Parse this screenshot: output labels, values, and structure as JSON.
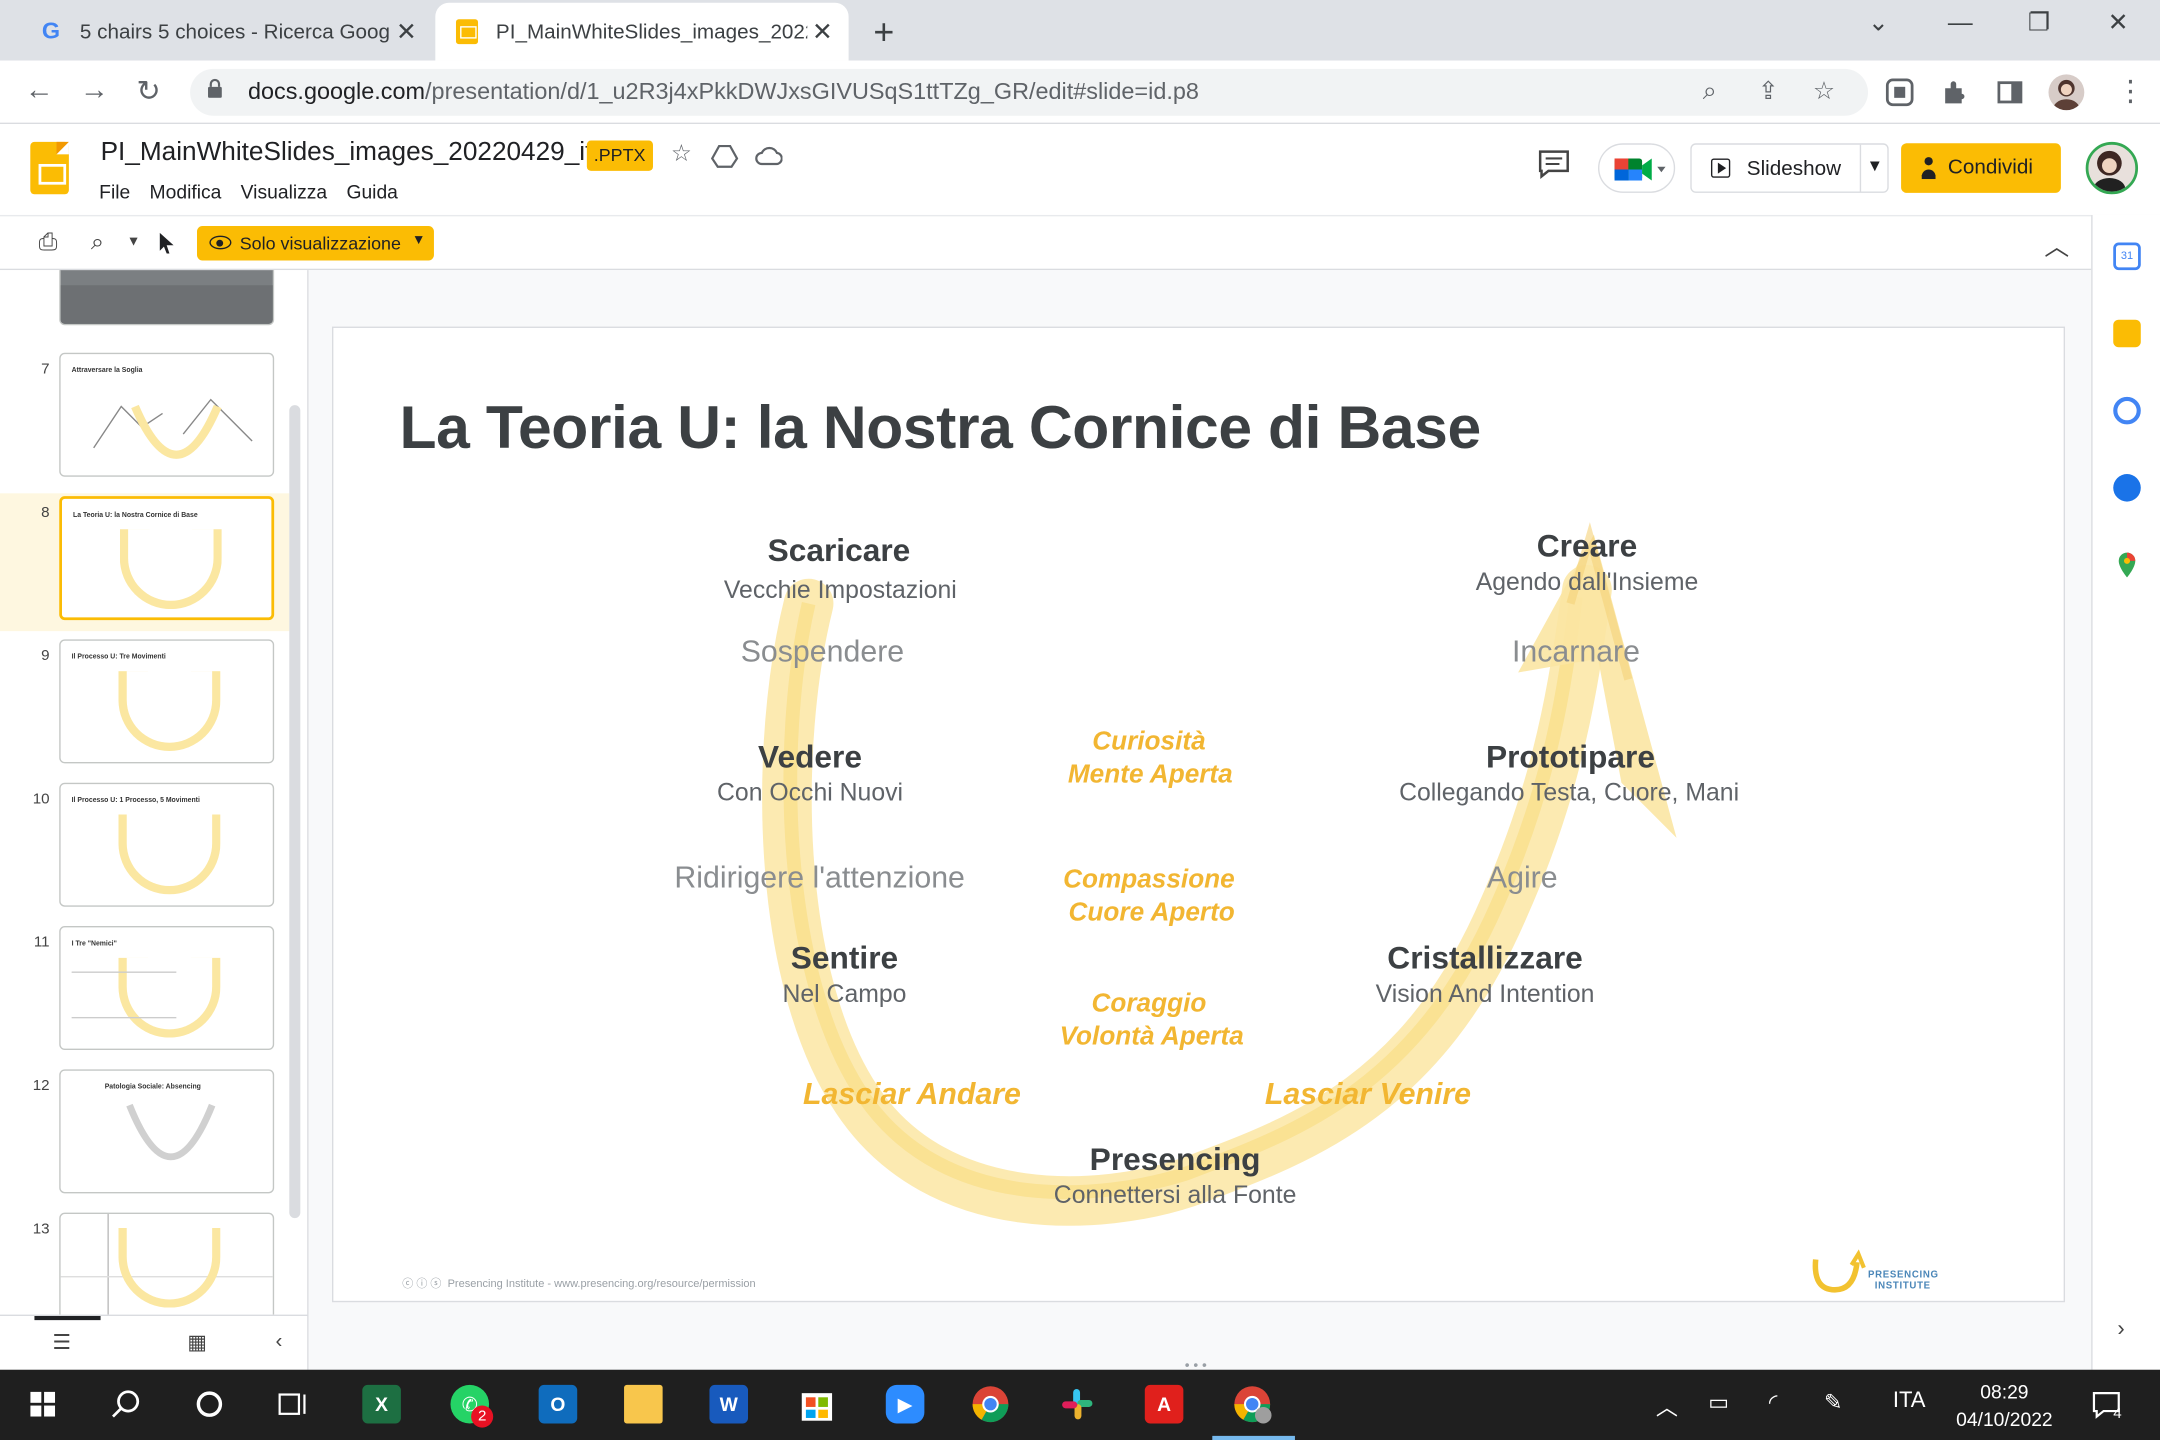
{
  "browser": {
    "tabs": [
      {
        "title": "5 chairs 5 choices - Ricerca Goog",
        "icon": "google-icon",
        "active": false
      },
      {
        "title": "PI_MainWhiteSlides_images_2022",
        "icon": "slides-icon",
        "active": true
      }
    ],
    "url_host": "docs.google.com",
    "url_path": "/presentation/d/1_u2R3j4xPkkDWJxsGIVUSqS1ttTZg_GR/edit#slide=id.p8"
  },
  "app": {
    "doc_title": "PI_MainWhiteSlides_images_20220429_it",
    "badge": ".PPTX",
    "menu": [
      "File",
      "Modifica",
      "Visualizza",
      "Guida"
    ],
    "slideshow_label": "Slideshow",
    "share_label": "Condividi",
    "view_mode_label": "Solo visualizzazione",
    "accent_color": "#fbbc04"
  },
  "filmstrip": {
    "selected": 8,
    "slides": [
      {
        "num": "7",
        "title": "Attraversare la Soglia"
      },
      {
        "num": "8",
        "title": "La Teoria U: la Nostra Cornice di Base"
      },
      {
        "num": "9",
        "title": "Il Processo U: Tre Movimenti"
      },
      {
        "num": "10",
        "title": "Il Processo U: 1 Processo, 5 Movimenti"
      },
      {
        "num": "11",
        "title": "I Tre \"Nemici\""
      },
      {
        "num": "12",
        "title": "Patologia Sociale: Absencing"
      },
      {
        "num": "13",
        "title": ""
      }
    ]
  },
  "slide": {
    "title": "La Teoria U: la Nostra Cornice di Base",
    "left": {
      "scaricare": "Scaricare",
      "scaricare_sub": "Vecchie Impostazioni",
      "sospendere": "Sospendere",
      "vedere": "Vedere",
      "vedere_sub": "Con Occhi Nuovi",
      "ridirigere": "Ridirigere l'attenzione",
      "sentire": "Sentire",
      "sentire_sub": "Nel Campo",
      "lasciar_andare": "Lasciar Andare"
    },
    "right": {
      "creare": "Creare",
      "creare_sub": "Agendo dall'Insieme",
      "incarnare": "Incarnare",
      "prototipare": "Prototipare",
      "prototipare_sub": "Collegando Testa, Cuore, Mani",
      "agire": "Agire",
      "cristallizzare": "Cristallizzare",
      "cristallizzare_sub": "Vision And Intention",
      "lasciar_venire": "Lasciar Venire"
    },
    "center": {
      "curiosita": "Curiosità",
      "mente": "Mente Aperta",
      "compassione": "Compassione",
      "cuore": "Cuore Aperto",
      "coraggio": "Coraggio",
      "volonta": "Volontà Aperta"
    },
    "bottom": {
      "presencing": "Presencing",
      "presencing_sub": "Connettersi alla Fonte"
    },
    "footnote": "Presencing Institute - www.presencing.org/resource/permission",
    "logo_text_1": "PRESENCING",
    "logo_text_2": "INSTITUTE"
  },
  "taskbar": {
    "language": "ITA",
    "time": "08:29",
    "date": "04/10/2022",
    "whatsapp_badge": "2",
    "notifications": "4"
  }
}
